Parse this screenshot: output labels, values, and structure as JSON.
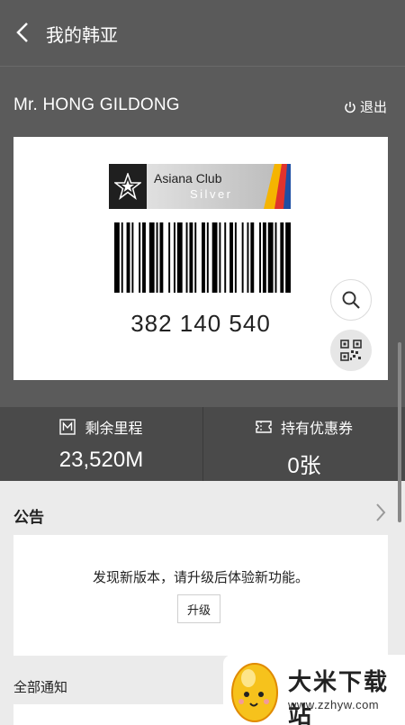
{
  "header": {
    "title": "我的韩亚",
    "back_icon": "chevron-left-icon"
  },
  "member": {
    "name": "Mr. HONG GILDONG",
    "logout_label": "退出",
    "logout_icon": "power-icon"
  },
  "card": {
    "logo_club": "Asiana Club",
    "logo_level": "Silver",
    "number": "382 140 540",
    "zoom_icon": "search-icon",
    "qr_icon": "qr-code-icon"
  },
  "stats": {
    "mileage_label": "剩余里程",
    "mileage_value": "23,520M",
    "mileage_icon": "mileage-m-icon",
    "coupon_label": "持有优惠券",
    "coupon_value": "0张",
    "coupon_icon": "ticket-icon"
  },
  "notice": {
    "heading": "公告",
    "message": "发现新版本，请升级后体验新功能。",
    "upgrade_label": "升级",
    "all_notices": "全部通知"
  },
  "watermark": {
    "title": "大米下载站",
    "url": "www.zzhyw.com"
  },
  "colors": {
    "header_bg": "#5a5a5a",
    "stats_bg": "#4a4a4a",
    "content_bg": "#ebebeb",
    "card_bg": "#ffffff"
  }
}
